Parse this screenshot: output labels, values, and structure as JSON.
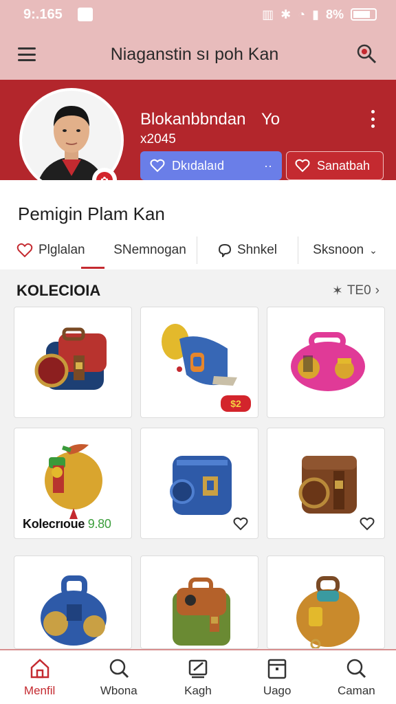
{
  "status_bar": {
    "time": "9:.165",
    "battery_text": "8%"
  },
  "app_bar": {
    "title": "Niaganstin sı poh Kan"
  },
  "profile": {
    "name": "Blokanbbndan",
    "name_suffix": "Yo",
    "subtitle": "x2045",
    "follow_label": "Dkıdalaıd",
    "follow_extra": "··",
    "save_label": "Sanatbah"
  },
  "info": {
    "title": "Pemigin Plam Kan",
    "tabs": [
      {
        "label": "Plglalan"
      },
      {
        "label": "SNemnogan"
      },
      {
        "label": "Shnkel"
      },
      {
        "label": "Sksnoon"
      }
    ]
  },
  "collection": {
    "title": "KOLECIOIA",
    "link": "TE0",
    "items": [
      {
        "name": "red-backpack"
      },
      {
        "name": "blue-cannon-bag",
        "badge": "$2"
      },
      {
        "name": "pink-pouch"
      },
      {
        "name": "orange-fruit-bag",
        "tag_label": "Kolecrıoue",
        "tag_price": "9.80"
      },
      {
        "name": "blue-cube-bag"
      },
      {
        "name": "brown-chest-bag"
      },
      {
        "name": "blue-round-bag"
      },
      {
        "name": "green-brown-bag"
      },
      {
        "name": "gold-round-bag"
      }
    ]
  },
  "bottom_nav": [
    {
      "label": "Menfil",
      "icon": "home-icon",
      "active": true
    },
    {
      "label": "Wbona",
      "icon": "search-icon",
      "active": false
    },
    {
      "label": "Kagh",
      "icon": "edit-icon",
      "active": false
    },
    {
      "label": "Uago",
      "icon": "calendar-icon",
      "active": false
    },
    {
      "label": "Caman",
      "icon": "search-icon",
      "active": false
    }
  ],
  "colors": {
    "brand_red": "#b3262c",
    "header_pink": "#e8bcbc",
    "follow_blue": "#6a7ee8",
    "price_green": "#3b9e3b"
  }
}
